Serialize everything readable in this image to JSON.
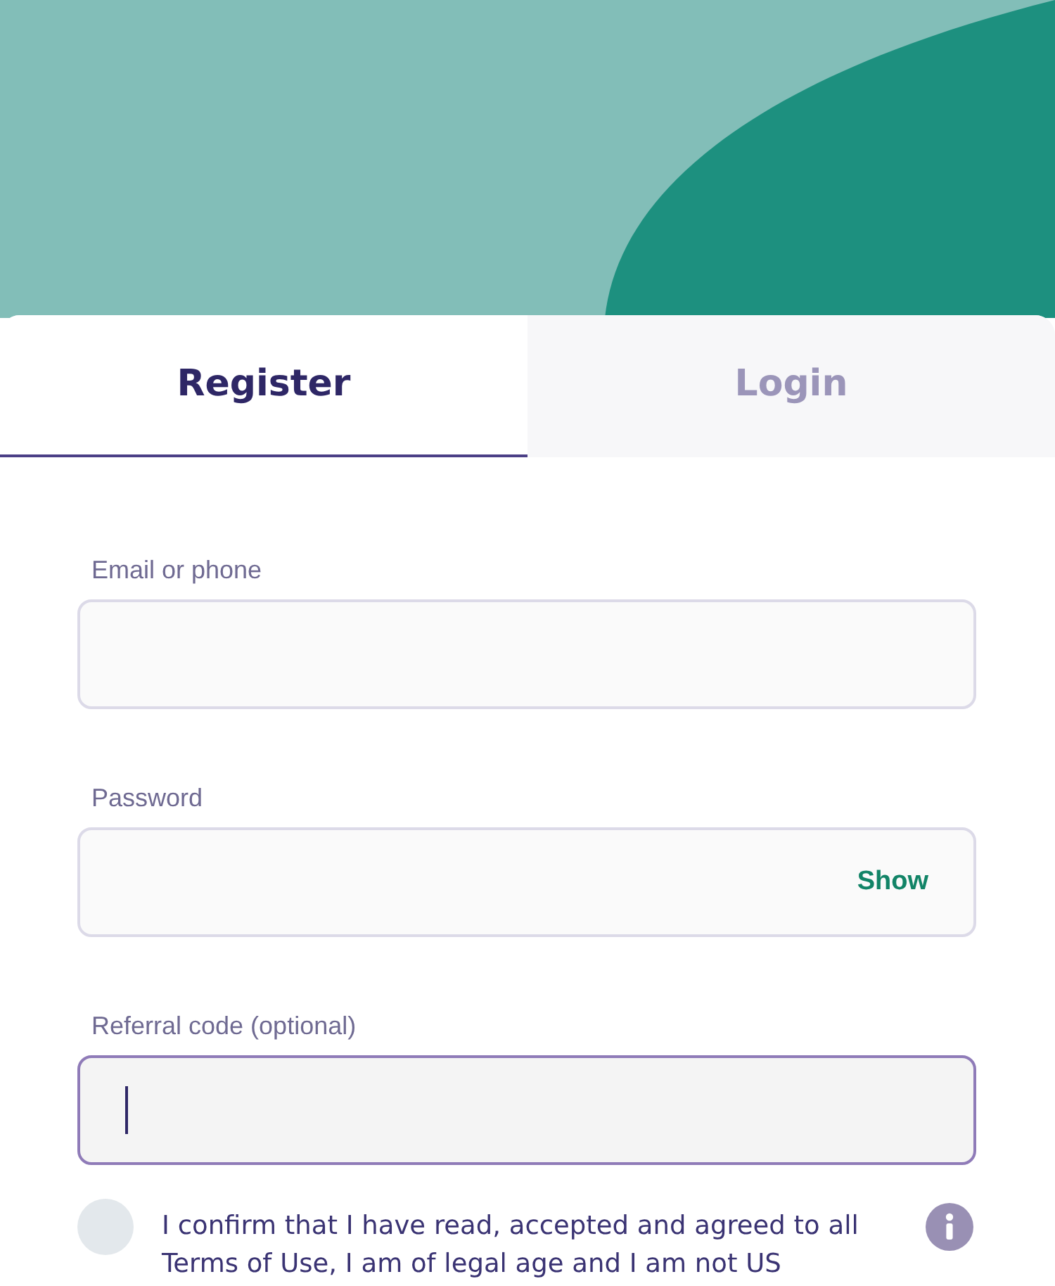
{
  "tabs": [
    {
      "label": "Register",
      "selected": true
    },
    {
      "label": "Login",
      "selected": false
    }
  ],
  "fields": [
    {
      "label": "Email or phone",
      "focused": false
    },
    {
      "label": "Password",
      "focused": false,
      "action": "Show"
    },
    {
      "label": "Referral code (optional)",
      "focused": true
    }
  ],
  "consent": {
    "checked": false,
    "text": "I confirm that I have read, accepted and agreed to all Terms of Use, I am of legal age and I am not US"
  }
}
